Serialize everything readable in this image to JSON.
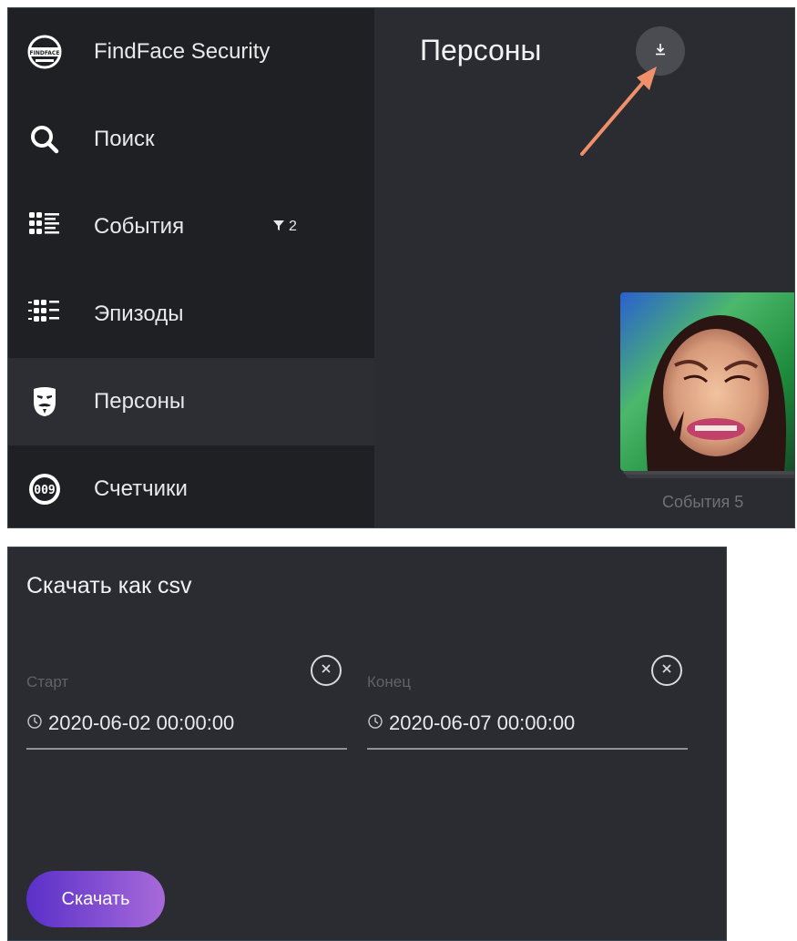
{
  "sidebar": {
    "brand": "FindFace Security",
    "items": [
      {
        "label": "FindFace Security",
        "icon": "findface-logo-icon"
      },
      {
        "label": "Поиск",
        "icon": "search-icon"
      },
      {
        "label": "События",
        "icon": "events-grid-icon",
        "filter_count": "2"
      },
      {
        "label": "Эпизоды",
        "icon": "episodes-icon"
      },
      {
        "label": "Персоны",
        "icon": "mask-icon",
        "active": true
      },
      {
        "label": "Счетчики",
        "icon": "counter-icon"
      }
    ]
  },
  "main": {
    "title": "Персоны",
    "download_icon": "download-icon",
    "person_card": {
      "events_label": "События 5"
    }
  },
  "dialog": {
    "title": "Скачать как csv",
    "start": {
      "label": "Старт",
      "value": "2020-06-02 00:00:00"
    },
    "end": {
      "label": "Конец",
      "value": "2020-06-07 00:00:00"
    },
    "submit_label": "Скачать"
  },
  "colors": {
    "sidebar_bg": "#1f2023",
    "main_bg": "#2a2c31",
    "annotation_arrow": "#f0906a",
    "button_gradient_start": "#5a30c9",
    "button_gradient_end": "#a76ad9"
  }
}
